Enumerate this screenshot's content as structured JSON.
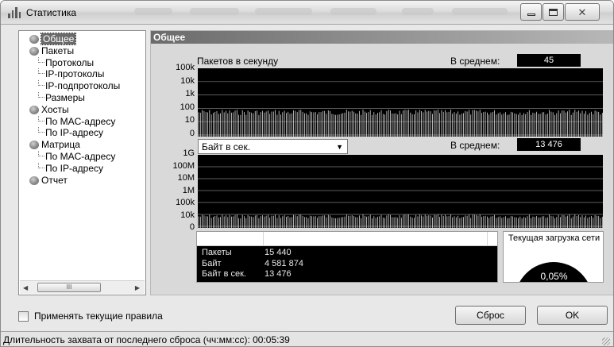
{
  "window": {
    "title": "Статистика"
  },
  "tree": {
    "items": [
      {
        "label": "Общее",
        "level": 0,
        "selected": true
      },
      {
        "label": "Пакеты",
        "level": 0
      },
      {
        "label": "Протоколы",
        "level": 1
      },
      {
        "label": "IP-протоколы",
        "level": 1
      },
      {
        "label": "IP-подпротоколы",
        "level": 1
      },
      {
        "label": "Размеры",
        "level": 1
      },
      {
        "label": "Хосты",
        "level": 0
      },
      {
        "label": "По MAC-адресу",
        "level": 1
      },
      {
        "label": "По IP-адресу",
        "level": 1
      },
      {
        "label": "Матрица",
        "level": 0
      },
      {
        "label": "По MAC-адресу",
        "level": 1
      },
      {
        "label": "По IP-адресу",
        "level": 1
      },
      {
        "label": "Отчет",
        "level": 0
      }
    ],
    "scroll_thumb": "III"
  },
  "panel": {
    "header": "Общее"
  },
  "packets_chart": {
    "title": "Пакетов в секунду",
    "avg_label": "В среднем:",
    "avg_value": "45",
    "y_ticks": [
      "100k",
      "10k",
      "1k",
      "100",
      "10",
      "0"
    ]
  },
  "bytes_chart": {
    "metric": "Байт в сек.",
    "avg_label": "В среднем:",
    "avg_value": "13 476",
    "y_ticks": [
      "1G",
      "100M",
      "10M",
      "1M",
      "100k",
      "10k",
      "0"
    ]
  },
  "summary": {
    "rows": [
      {
        "key": "Пакеты",
        "value": "15 440"
      },
      {
        "key": "Байт",
        "value": "4 581 874"
      },
      {
        "key": "Байт в сек.",
        "value": "13 476"
      }
    ]
  },
  "load": {
    "title": "Текущая загрузка сети",
    "percent": "0,05%"
  },
  "footer": {
    "apply_rules_label": "Применять текущие правила",
    "apply_rules_checked": false,
    "reset_label": "Сброс",
    "ok_label": "OK"
  },
  "status": {
    "text": "Длительность захвата от последнего сброса (чч:мм:сс): 00:05:39"
  },
  "colors": {
    "graph_bg": "#000000",
    "grid": "#7a7a7a",
    "trace": "#d9d9d9",
    "header_bar": "#6b6b6b"
  }
}
